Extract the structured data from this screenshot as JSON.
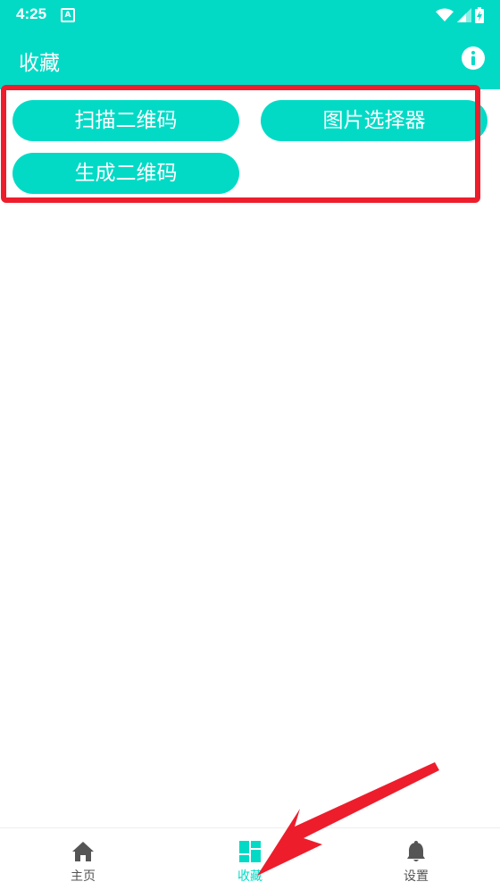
{
  "status_bar": {
    "time": "4:25",
    "notification_icon": "a-icon",
    "wifi_icon": "wifi-icon",
    "signal_icon": "signal-icon",
    "battery_icon": "battery-icon"
  },
  "app_bar": {
    "title": "收藏",
    "info_icon": "info-icon"
  },
  "colors": {
    "accent": "#03dac6",
    "highlight": "#ee1d2c",
    "nav_inactive": "#555555"
  },
  "buttons": {
    "scan_qr": "扫描二维码",
    "image_picker": "图片选择器",
    "generate_qr": "生成二维码"
  },
  "bottom_nav": {
    "items": [
      {
        "label": "主页",
        "icon": "home-icon",
        "active": false
      },
      {
        "label": "收藏",
        "icon": "dashboard-icon",
        "active": true
      },
      {
        "label": "设置",
        "icon": "bell-icon",
        "active": false
      }
    ]
  }
}
